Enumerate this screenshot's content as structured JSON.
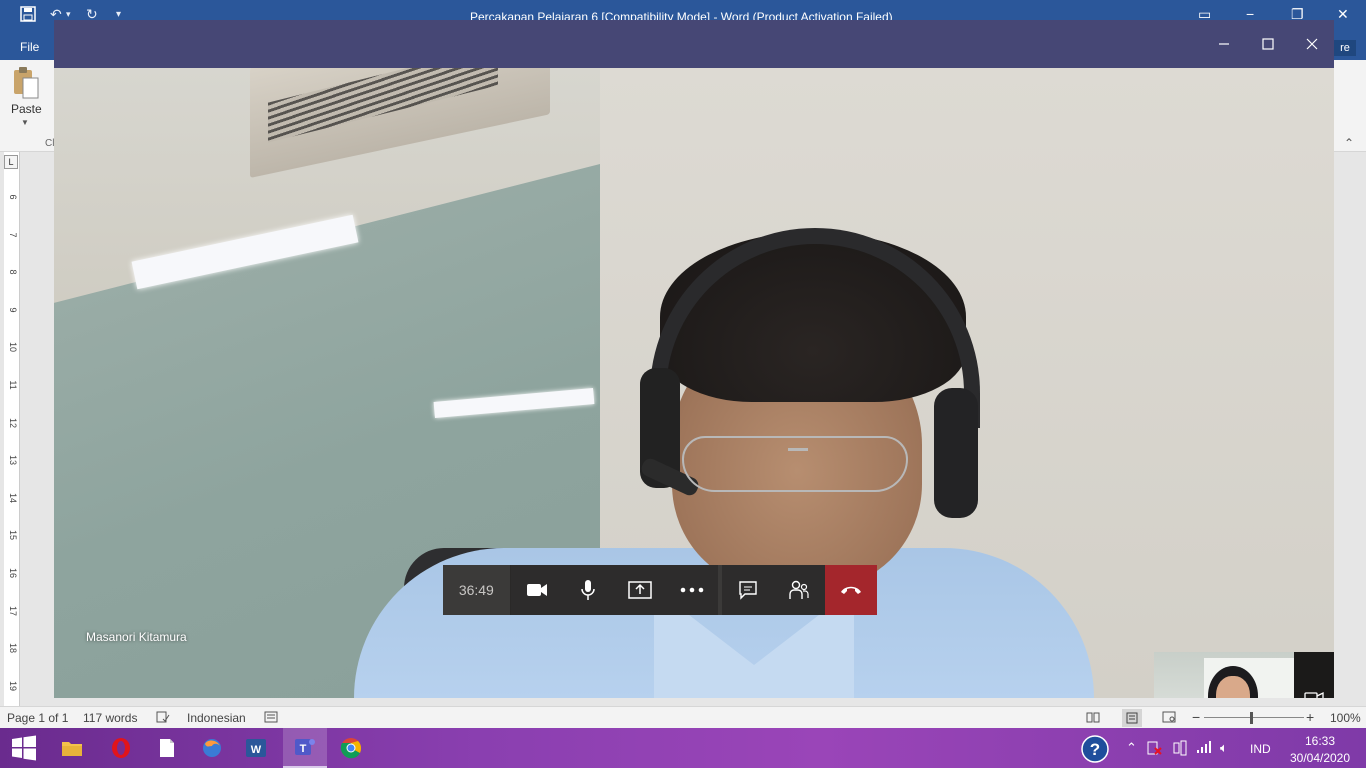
{
  "word": {
    "window_title": "Percakapan Pelajaran 6 [Compatibility Mode] - Word (Product Activation Failed)",
    "file_tab": "File",
    "share_fragment": "re",
    "paste_label": "Paste",
    "clipboard_fragment": "Cl",
    "ruler_marks": [
      "6",
      "7",
      "8",
      "9",
      "10",
      "11",
      "12",
      "13",
      "14",
      "15",
      "16",
      "17",
      "18",
      "19"
    ],
    "status": {
      "page": "Page 1 of 1",
      "words": "117 words",
      "language": "Indonesian",
      "zoom": "100%"
    }
  },
  "teams": {
    "participant_name": "Masanori Kitamura",
    "call_duration": "36:49"
  },
  "taskbar": {
    "apps": [
      "windows-start",
      "file-explorer",
      "opera",
      "notepad",
      "firefox",
      "word",
      "teams",
      "chrome"
    ],
    "language": "IND",
    "time": "16:33",
    "date": "30/04/2020"
  },
  "colors": {
    "word_blue": "#2b579a",
    "teams_purple": "#464775",
    "hangup_red": "#a4262c",
    "call_bar": "#2d2c2c"
  }
}
